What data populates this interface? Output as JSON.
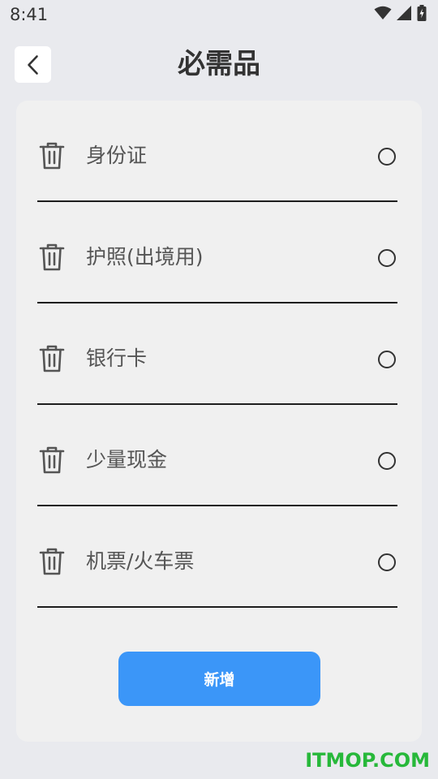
{
  "status_bar": {
    "time": "8:41",
    "icons": [
      "wifi-icon",
      "cellular-signal-icon",
      "battery-charging-icon"
    ]
  },
  "header": {
    "title": "必需品",
    "back_icon": "chevron-left-icon"
  },
  "items": [
    {
      "label": "身份证",
      "checked": false
    },
    {
      "label": "护照(出境用)",
      "checked": false
    },
    {
      "label": "银行卡",
      "checked": false
    },
    {
      "label": "少量现金",
      "checked": false
    },
    {
      "label": "机票/火车票",
      "checked": false
    }
  ],
  "add_button": {
    "label": "新增"
  },
  "watermark": "ITMOP.COM",
  "colors": {
    "background": "#e9eaee",
    "card": "#f0f0f0",
    "accent": "#3b96f8",
    "watermark": "#27b83a"
  }
}
